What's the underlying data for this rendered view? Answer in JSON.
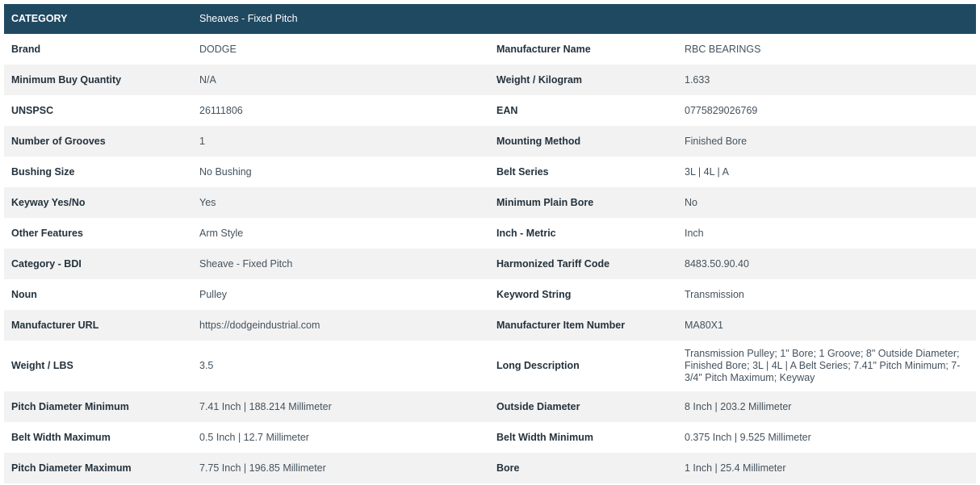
{
  "header": {
    "label": "CATEGORY",
    "value": "Sheaves - Fixed Pitch"
  },
  "rows": [
    {
      "k1": "Brand",
      "v1": "DODGE",
      "k2": "Manufacturer Name",
      "v2": "RBC BEARINGS"
    },
    {
      "k1": "Minimum Buy Quantity",
      "v1": "N/A",
      "k2": "Weight / Kilogram",
      "v2": "1.633"
    },
    {
      "k1": "UNSPSC",
      "v1": "26111806",
      "k2": "EAN",
      "v2": "0775829026769"
    },
    {
      "k1": "Number of Grooves",
      "v1": "1",
      "k2": "Mounting Method",
      "v2": "Finished Bore"
    },
    {
      "k1": "Bushing Size",
      "v1": "No Bushing",
      "k2": "Belt Series",
      "v2": "3L | 4L | A"
    },
    {
      "k1": "Keyway Yes/No",
      "v1": "Yes",
      "k2": "Minimum Plain Bore",
      "v2": "No"
    },
    {
      "k1": "Other Features",
      "v1": "Arm Style",
      "k2": "Inch - Metric",
      "v2": "Inch"
    },
    {
      "k1": "Category - BDI",
      "v1": "Sheave - Fixed Pitch",
      "k2": "Harmonized Tariff Code",
      "v2": "8483.50.90.40"
    },
    {
      "k1": "Noun",
      "v1": "Pulley",
      "k2": "Keyword String",
      "v2": "Transmission"
    },
    {
      "k1": "Manufacturer URL",
      "v1": "https://dodgeindustrial.com",
      "k2": "Manufacturer Item Number",
      "v2": "MA80X1"
    },
    {
      "k1": "Weight / LBS",
      "v1": "3.5",
      "k2": "Long Description",
      "v2": "Transmission Pulley; 1\" Bore; 1 Groove; 8\" Outside Diameter; Finished Bore; 3L | 4L | A Belt Series; 7.41\" Pitch Minimum; 7-3/4\" Pitch Maximum; Keyway"
    },
    {
      "k1": "Pitch Diameter Minimum",
      "v1": "7.41 Inch | 188.214 Millimeter",
      "k2": "Outside Diameter",
      "v2": "8 Inch | 203.2 Millimeter"
    },
    {
      "k1": "Belt Width Maximum",
      "v1": "0.5 Inch | 12.7 Millimeter",
      "k2": "Belt Width Minimum",
      "v2": "0.375 Inch | 9.525 Millimeter"
    },
    {
      "k1": "Pitch Diameter Maximum",
      "v1": "7.75 Inch | 196.85 Millimeter",
      "k2": "Bore",
      "v2": "1 Inch | 25.4 Millimeter"
    }
  ]
}
